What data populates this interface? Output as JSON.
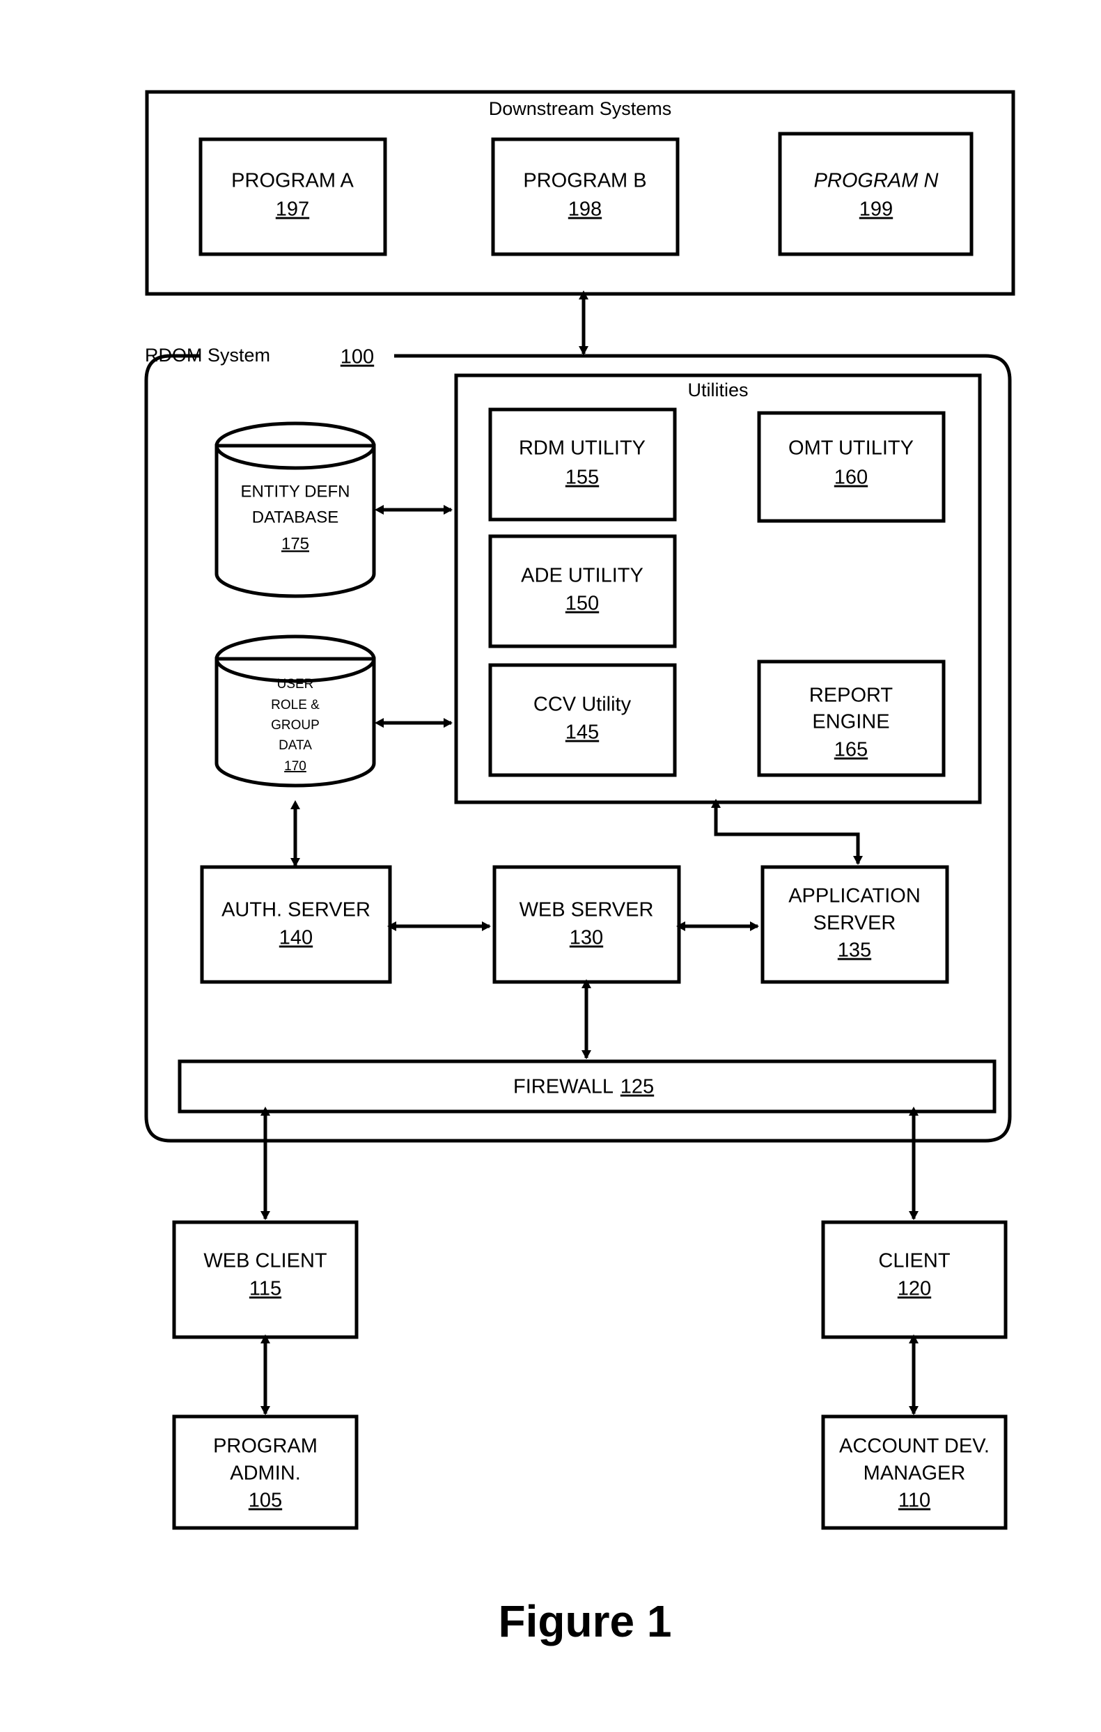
{
  "figure": {
    "caption": "Figure 1"
  },
  "downstream": {
    "title": "Downstream Systems",
    "programs": [
      {
        "label": "PROGRAM A",
        "label_plain": "PROGRAM ",
        "label_italic": "",
        "ref": "197"
      },
      {
        "label": "PROGRAM B",
        "label_plain": "PROGRAM ",
        "label_italic": "",
        "ref": "198"
      },
      {
        "label": "PROGRAM N",
        "label_plain": "PROGRAM ",
        "label_italic": "N",
        "ref": "199"
      }
    ]
  },
  "rdom": {
    "title": "RDOM System",
    "ref": "100"
  },
  "utilities": {
    "title": "Utilities",
    "items": [
      {
        "label": "RDM UTILITY",
        "ref": "155"
      },
      {
        "label": "OMT UTILITY",
        "ref": "160"
      },
      {
        "label": "ADE UTILITY",
        "ref": "150"
      },
      {
        "label": "CCV Utility",
        "ref": "145"
      },
      {
        "label_line1": "REPORT",
        "label_line2": "ENGINE",
        "label": "REPORT ENGINE",
        "ref": "165"
      }
    ]
  },
  "databases": [
    {
      "name": "entity-defn-database",
      "line1": "ENTITY DEFN",
      "line2": "DATABASE",
      "ref": "175"
    },
    {
      "name": "user-role-group-data",
      "line1": "USER",
      "line2": "ROLE &",
      "line3": "GROUP",
      "line4": "DATA",
      "ref": "170"
    }
  ],
  "servers": [
    {
      "name": "auth-server",
      "label": "AUTH. SERVER",
      "ref": "140"
    },
    {
      "name": "web-server",
      "label": "WEB SERVER",
      "ref": "130"
    },
    {
      "name": "application-server",
      "line1": "APPLICATION",
      "line2": "SERVER",
      "label": "APPLICATION SERVER",
      "ref": "135"
    }
  ],
  "firewall": {
    "label": "FIREWALL",
    "ref": "125"
  },
  "clients": [
    {
      "name": "web-client",
      "label": "WEB CLIENT",
      "ref": "115"
    },
    {
      "name": "client",
      "label": "CLIENT",
      "ref": "120"
    }
  ],
  "actors": [
    {
      "name": "program-admin",
      "line1": "PROGRAM",
      "line2": "ADMIN.",
      "label": "PROGRAM ADMIN.",
      "ref": "105"
    },
    {
      "name": "account-dev-manager",
      "line1": "ACCOUNT DEV.",
      "line2": "MANAGER",
      "label": "ACCOUNT DEV. MANAGER",
      "ref": "110"
    }
  ],
  "colors": {
    "stroke": "#000000",
    "background": "#ffffff"
  }
}
